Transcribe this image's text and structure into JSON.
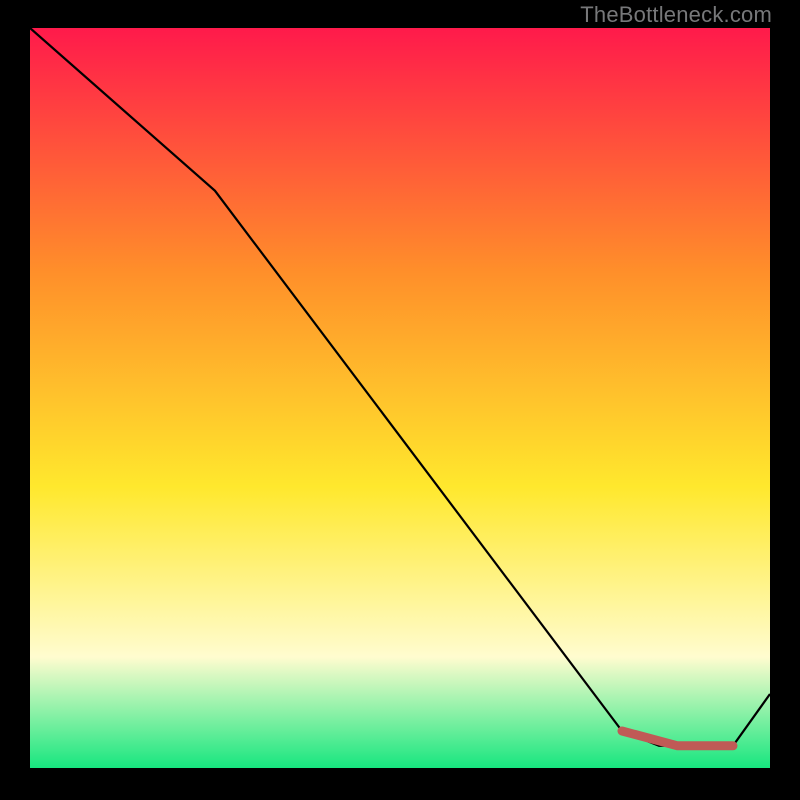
{
  "watermark": "TheBottleneck.com",
  "colors": {
    "gradient_top": "#ff1a4b",
    "gradient_mid_upper": "#ff8f2a",
    "gradient_mid": "#ffe82d",
    "gradient_lower": "#fffccf",
    "gradient_bottom": "#17e67f",
    "line": "#000000",
    "flat_segment": "#c05a56",
    "background": "#000000"
  },
  "chart_data": {
    "type": "line",
    "title": "",
    "xlabel": "",
    "ylabel": "",
    "x": [
      0,
      25,
      80,
      85,
      95,
      100
    ],
    "values": [
      100,
      78,
      5,
      3,
      3,
      10
    ],
    "ylim": [
      0,
      100
    ],
    "xlim": [
      0,
      100
    ],
    "flat_region": {
      "x_start": 80,
      "x_end": 95,
      "y_start": 5,
      "y_end": 3
    },
    "grid": false
  }
}
